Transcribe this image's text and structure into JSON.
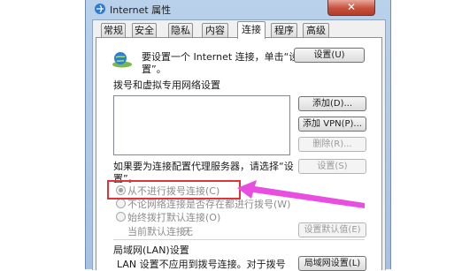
{
  "window": {
    "title": "Internet 属性",
    "close": "✕"
  },
  "tabs": [
    {
      "label": "常规"
    },
    {
      "label": "安全"
    },
    {
      "label": "隐私"
    },
    {
      "label": "内容"
    },
    {
      "label": "连接",
      "active": true
    },
    {
      "label": "程序"
    },
    {
      "label": "高级"
    }
  ],
  "setup": {
    "text_line1": "要设置一个 Internet 连接，单击“设",
    "text_line2": "置”。",
    "button": "设置(U)"
  },
  "dialup": {
    "heading": "拨号和虚拟专用网络设置",
    "add_button": "添加(D)...",
    "add_vpn_button": "添加 VPN(P)...",
    "remove_button": "删除(R)...",
    "proxy_text_line1": "如果要为连接配置代理服务器，请选择“设",
    "proxy_text_line2": "置”。",
    "settings_button": "设置(S)",
    "options": [
      {
        "label": "从不进行拨号连接(C)",
        "selected": true
      },
      {
        "label": "不论网络连接是否存在都进行拨号(W)",
        "selected": false
      },
      {
        "label": "始终拨打默认连接(O)",
        "selected": false
      }
    ],
    "current_default_label": "当前默认连接：",
    "current_default_value": "无",
    "set_default_button": "设置默认值(E)"
  },
  "lan": {
    "heading": "局域网(LAN)设置",
    "text_line1": "LAN 设置不应用到拨号连接。对于拨号",
    "settings_button": "局域网设置(L)"
  },
  "annotation": {
    "highlight_color": "#e0343a",
    "arrow_color": "#e84ee0"
  }
}
